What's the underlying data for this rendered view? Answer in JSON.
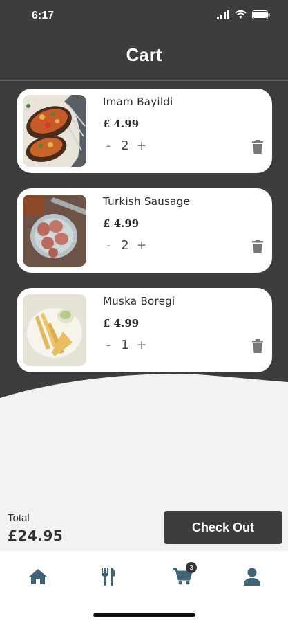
{
  "status_bar": {
    "time": "6:17"
  },
  "header": {
    "title": "Cart"
  },
  "cart": {
    "items": [
      {
        "name": "Imam Bayildi",
        "price": "£ 4.99",
        "quantity": "2",
        "minus": "-",
        "plus": "+"
      },
      {
        "name": "Turkish Sausage",
        "price": "£ 4.99",
        "quantity": "2",
        "minus": "-",
        "plus": "+"
      },
      {
        "name": "Muska Boregi",
        "price": "£ 4.99",
        "quantity": "1",
        "minus": "-",
        "plus": "+"
      }
    ]
  },
  "footer": {
    "total_label": "Total",
    "total_value": "£24.95",
    "checkout_label": "Check Out"
  },
  "nav": {
    "items": [
      "home-icon",
      "utensils-icon",
      "cart-icon",
      "user-icon"
    ],
    "cart_badge": "3"
  },
  "colors": {
    "dark": "#3d3d3d",
    "accent": "#3f6478",
    "background": "#f2f2f2"
  }
}
